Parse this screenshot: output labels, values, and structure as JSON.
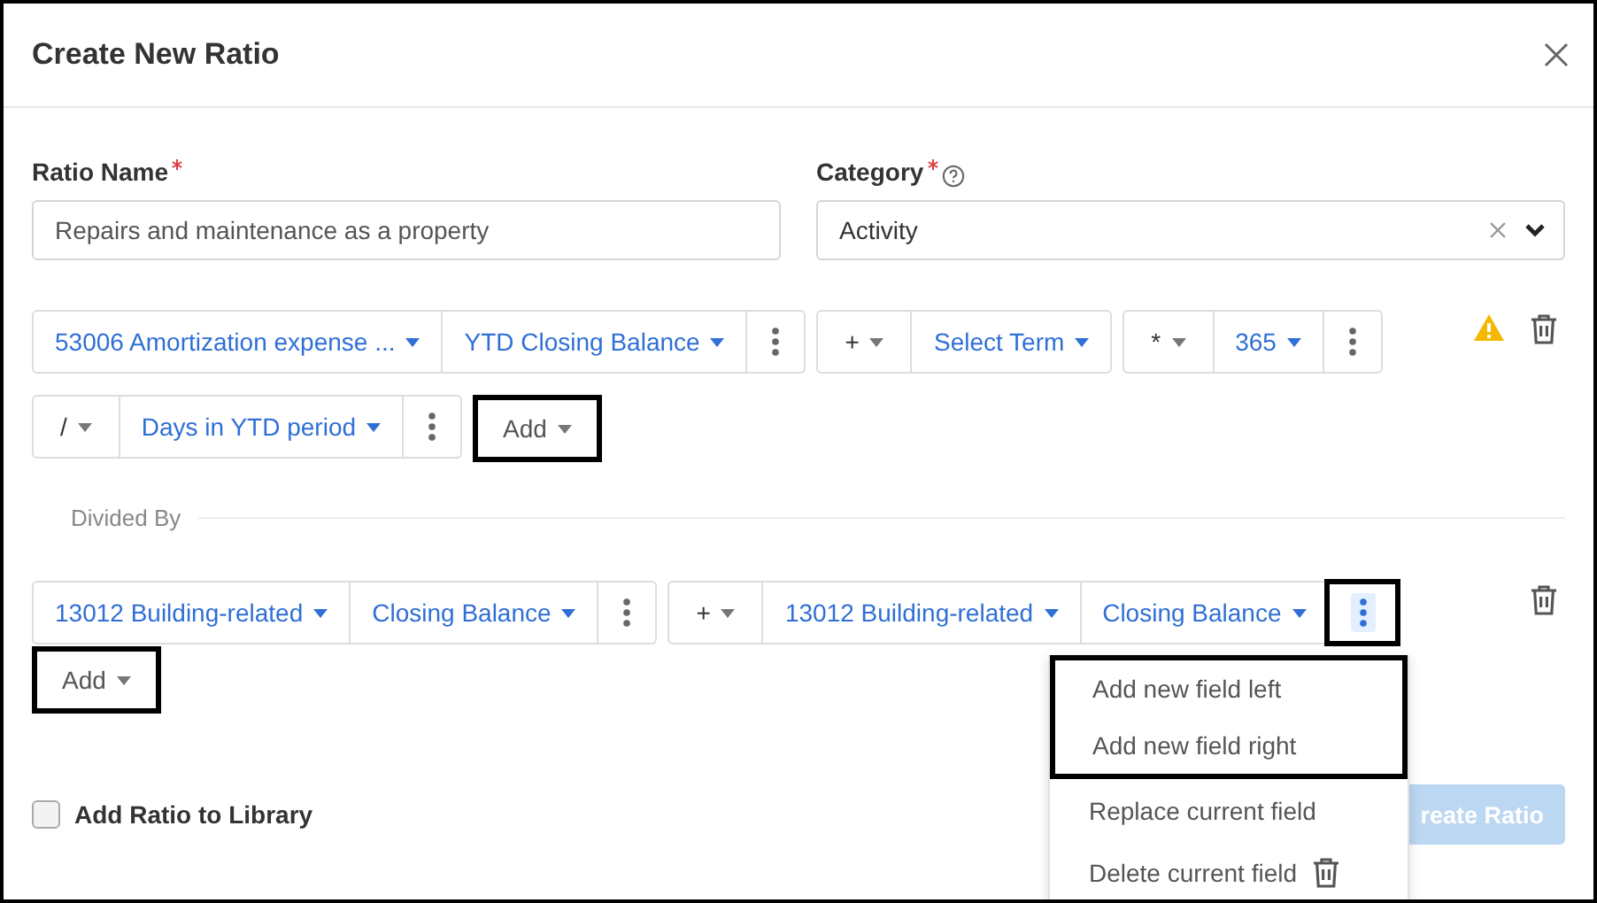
{
  "dialog": {
    "title": "Create New Ratio"
  },
  "fields": [
    {
      "label": "Ratio Name",
      "required": true,
      "help": false,
      "kind": "text",
      "value": "Repairs and maintenance as a property"
    },
    {
      "label": "Category",
      "required": true,
      "help": true,
      "kind": "select",
      "value": "Activity"
    }
  ],
  "numerator": {
    "warning": true,
    "groups": [
      [
        {
          "kind": "field",
          "text": "53006 Amortization expense ..."
        },
        {
          "kind": "field",
          "text": "YTD Closing Balance"
        },
        {
          "kind": "more",
          "highlighted": false
        }
      ],
      [
        {
          "kind": "operator",
          "text": "+"
        },
        {
          "kind": "field",
          "text": "Select Term"
        }
      ],
      [
        {
          "kind": "operator",
          "text": "*"
        },
        {
          "kind": "field",
          "text": "365"
        },
        {
          "kind": "more",
          "highlighted": false
        }
      ],
      [
        {
          "kind": "operator",
          "text": "/"
        },
        {
          "kind": "field",
          "text": "Days in YTD period"
        },
        {
          "kind": "more",
          "highlighted": false
        }
      ]
    ],
    "add": {
      "label": "Add",
      "highlighted": true
    }
  },
  "divider_label": "Divided By",
  "denominator": {
    "warning": false,
    "groups": [
      [
        {
          "kind": "field",
          "text": "13012 Building-related"
        },
        {
          "kind": "field",
          "text": "Closing Balance"
        },
        {
          "kind": "more",
          "highlighted": false
        }
      ],
      [
        {
          "kind": "operator",
          "text": "+"
        },
        {
          "kind": "field",
          "text": "13012 Building-related"
        },
        {
          "kind": "field",
          "text": "Closing Balance"
        },
        {
          "kind": "more",
          "highlighted": true
        }
      ]
    ],
    "add": {
      "label": "Add",
      "highlighted": true
    }
  },
  "library_checkbox": {
    "label": "Add Ratio to Library",
    "checked": false
  },
  "submit": {
    "label": "reate Ratio",
    "disabled": true
  },
  "menu": {
    "items": [
      {
        "kind": "plain",
        "label": "Add new field left",
        "highlighted": true
      },
      {
        "kind": "plain",
        "label": "Add new field right",
        "highlighted": true
      },
      {
        "kind": "plain",
        "label": "Replace current field",
        "highlighted": false
      },
      {
        "kind": "delete",
        "label": "Delete current field",
        "highlighted": false
      }
    ]
  }
}
